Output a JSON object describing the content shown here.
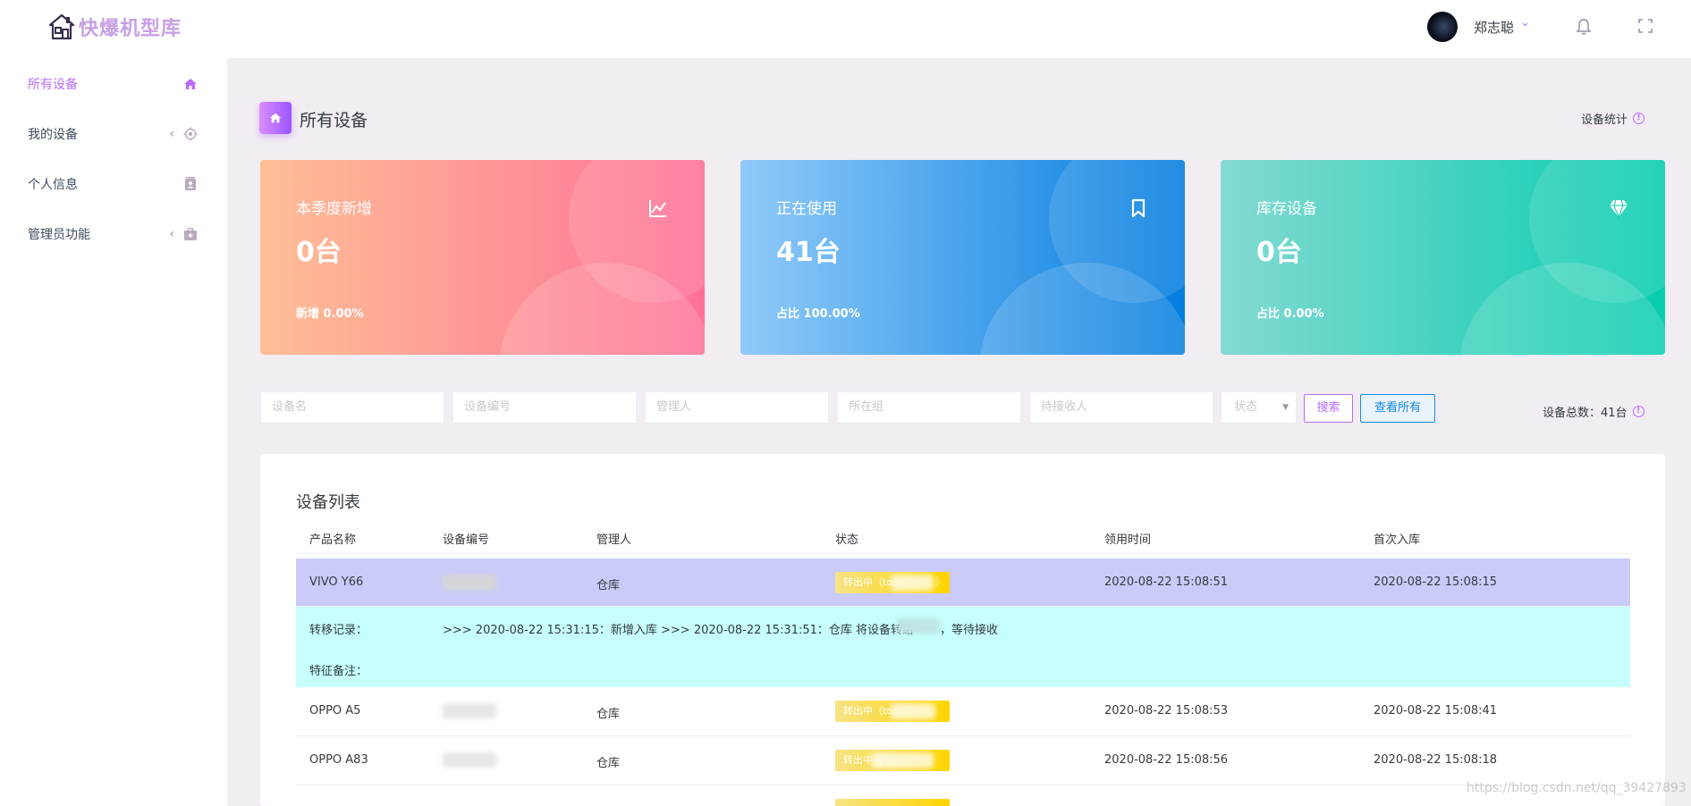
{
  "brand": {
    "name": "快爆机型库",
    "icon": "house-icon"
  },
  "user": {
    "name": "郑志聪",
    "avatar": "avatar"
  },
  "sidebar": {
    "items": [
      {
        "label": "所有设备",
        "icon": "home-icon",
        "active": true,
        "expandable": false
      },
      {
        "label": "我的设备",
        "icon": "crosshair-icon",
        "active": false,
        "expandable": true
      },
      {
        "label": "个人信息",
        "icon": "contacts-icon",
        "active": false,
        "expandable": false
      },
      {
        "label": "管理员功能",
        "icon": "medical-bag-icon",
        "active": false,
        "expandable": true
      }
    ]
  },
  "page": {
    "title": "所有设备",
    "stats_link": "设备统计"
  },
  "cards": [
    {
      "title": "本季度新增",
      "value": "0台",
      "foot": "新增 0.00%",
      "icon": "chart-line-icon",
      "color_from": "#ffbf96",
      "color_to": "#fe7096"
    },
    {
      "title": "正在使用",
      "value": "41台",
      "foot": "占比 100.00%",
      "icon": "bookmark-icon",
      "color_from": "#90caf9",
      "color_to": "#047edf"
    },
    {
      "title": "库存设备",
      "value": "0台",
      "foot": "占比 0.00%",
      "icon": "diamond-icon",
      "color_from": "#84d9d2",
      "color_to": "#07cdae"
    }
  ],
  "filters": {
    "name_placeholder": "设备名",
    "code_placeholder": "设备编号",
    "manager_placeholder": "管理人",
    "group_placeholder": "所在组",
    "receiver_placeholder": "待接收人",
    "status_selected": "状态",
    "search_label": "搜索",
    "view_all_label": "查看所有",
    "total_label": "设备总数：41台"
  },
  "table": {
    "title": "设备列表",
    "columns": [
      "产品名称",
      "设备编号",
      "管理人",
      "状态",
      "领用时间",
      "首次入库"
    ],
    "rows": [
      {
        "product": "VIVO Y66",
        "manager": "仓库",
        "status": "转出中（to",
        "status_end": "）",
        "borrow_time": "2020-08-22 15:08:51",
        "first_in": "2020-08-22 15:08:15"
      },
      {
        "product": "OPPO A5",
        "manager": "仓库",
        "status": "转出中（to",
        "status_end": "",
        "borrow_time": "2020-08-22 15:08:53",
        "first_in": "2020-08-22 15:08:41"
      },
      {
        "product": "OPPO A83",
        "manager": "仓库",
        "status": "转出中（",
        "status_end": "",
        "borrow_time": "2020-08-22 15:08:56",
        "first_in": "2020-08-22 15:08:18"
      }
    ],
    "detail": {
      "transfer_label": "转移记录：",
      "transfer_text": ">>> 2020-08-22 15:31:15：新增入库 >>> 2020-08-22 15:31:51：仓库 将设备转给",
      "transfer_tail": "，等待接收",
      "feature_label": "特征备注："
    }
  },
  "watermark": "https://blog.csdn.net/qq_39427893",
  "colors": {
    "accent": "#b66dff",
    "info": "#198ae3",
    "selected_row": "#cbcbf9",
    "detail_bg": "#c6fffc",
    "warning": "#ffd500"
  }
}
